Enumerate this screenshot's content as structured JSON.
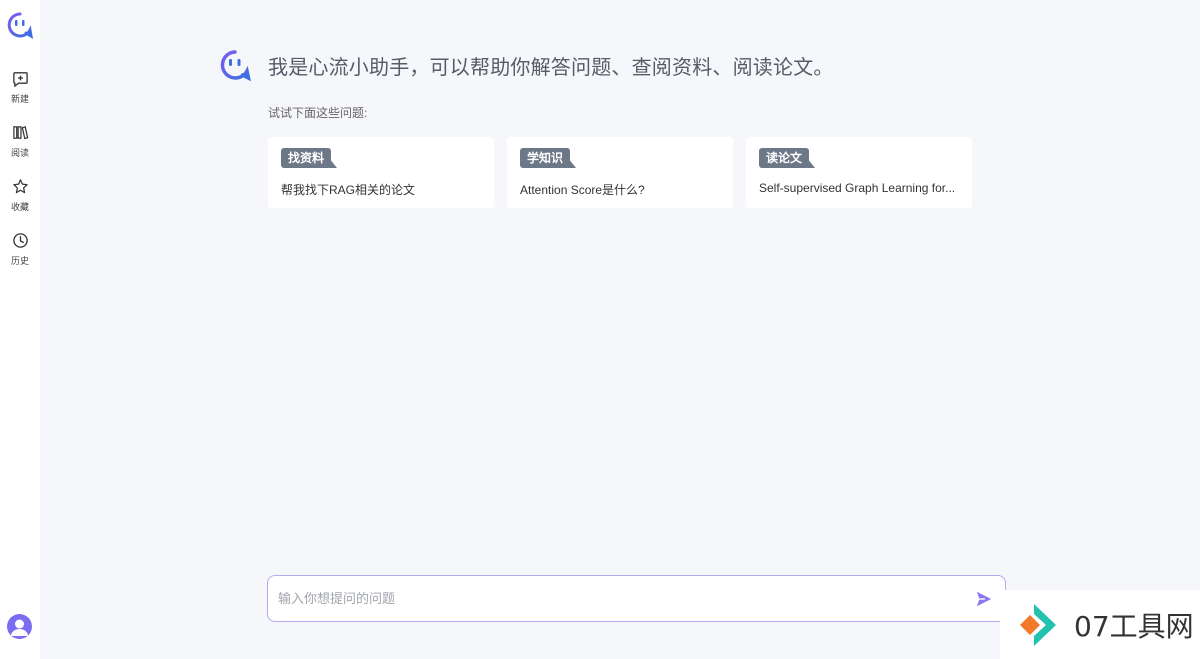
{
  "sidebar": {
    "items": [
      {
        "label": "新建",
        "icon": "new-chat-icon"
      },
      {
        "label": "阅读",
        "icon": "books-icon"
      },
      {
        "label": "收藏",
        "icon": "star-icon"
      },
      {
        "label": "历史",
        "icon": "clock-icon"
      }
    ]
  },
  "welcome": {
    "message": "我是心流小助手，可以帮助你解答问题、查阅资料、阅读论文。"
  },
  "suggestions": {
    "label": "试试下面这些问题:",
    "cards": [
      {
        "tag": "找资料",
        "text": "帮我找下RAG相关的论文"
      },
      {
        "tag": "学知识",
        "text": "Attention Score是什么?"
      },
      {
        "tag": "读论文",
        "text": "Self-supervised Graph Learning for..."
      }
    ]
  },
  "input": {
    "placeholder": "输入你想提问的问题",
    "value": ""
  },
  "watermark": {
    "text": "07工具网"
  },
  "colors": {
    "brand": "#6b5ce7",
    "brand_blue": "#3b6fe0",
    "tag_bg": "#6c7787",
    "input_border": "#b5abf0",
    "send": "#8a78f0"
  }
}
